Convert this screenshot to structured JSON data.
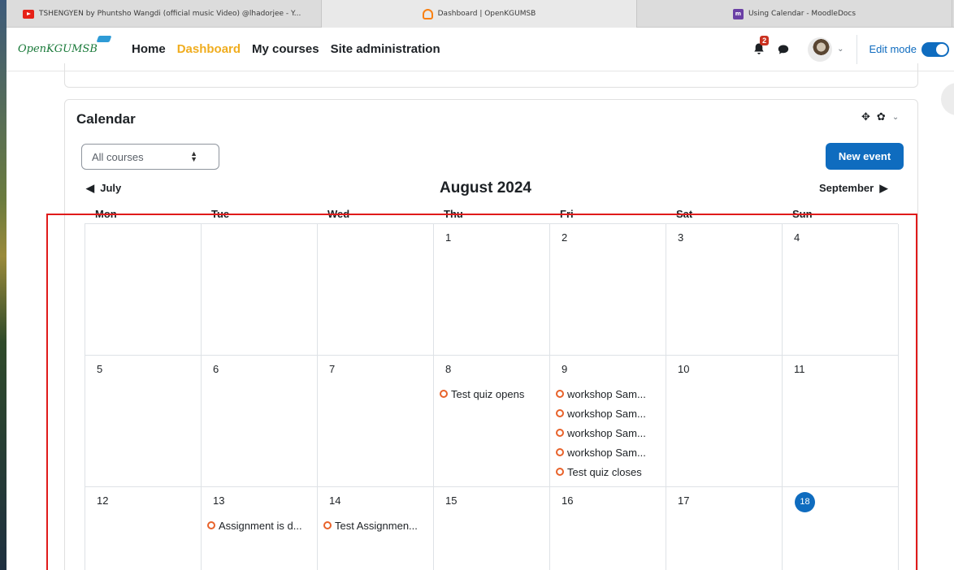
{
  "browser": {
    "tabs": [
      {
        "title": "TSHENGYEN by Phuntsho Wangdi (official music Video) @lhadorjee - Y...",
        "icon": "youtube-icon"
      },
      {
        "title": "Dashboard | OpenKGUMSB",
        "icon": "moodle-icon",
        "active": true
      },
      {
        "title": "Using Calendar - MoodleDocs",
        "icon": "moodledocs-icon"
      }
    ]
  },
  "nav": {
    "brand": "OpenKGUMSB",
    "links": [
      "Home",
      "Dashboard",
      "My courses",
      "Site administration"
    ],
    "active_link": "Dashboard",
    "notification_count": "2",
    "edit_mode_label": "Edit mode",
    "edit_mode_on": true
  },
  "calendar": {
    "block_title": "Calendar",
    "course_filter": "All courses",
    "new_event_label": "New event",
    "prev_month": "July",
    "current_month": "August 2024",
    "next_month": "September",
    "weekdays": [
      "Mon",
      "Tue",
      "Wed",
      "Thu",
      "Fri",
      "Sat",
      "Sun"
    ],
    "today": "18",
    "weeks": [
      [
        {
          "day": ""
        },
        {
          "day": ""
        },
        {
          "day": ""
        },
        {
          "day": "1"
        },
        {
          "day": "2"
        },
        {
          "day": "3"
        },
        {
          "day": "4"
        }
      ],
      [
        {
          "day": "5"
        },
        {
          "day": "6"
        },
        {
          "day": "7"
        },
        {
          "day": "8",
          "events": [
            "Test quiz opens"
          ]
        },
        {
          "day": "9",
          "events": [
            "workshop Sam...",
            "workshop Sam...",
            "workshop Sam...",
            "workshop Sam...",
            "Test quiz closes"
          ]
        },
        {
          "day": "10"
        },
        {
          "day": "11"
        }
      ],
      [
        {
          "day": "12"
        },
        {
          "day": "13",
          "events": [
            "Assignment is d..."
          ]
        },
        {
          "day": "14",
          "events": [
            "Test Assignmen..."
          ]
        },
        {
          "day": "15"
        },
        {
          "day": "16"
        },
        {
          "day": "17"
        },
        {
          "day": "18"
        }
      ]
    ]
  },
  "colors": {
    "accent": "#0f6cbf",
    "active_nav": "#f0ad1f",
    "event_icon": "#e8622a",
    "highlight_box": "#e01b1b"
  }
}
